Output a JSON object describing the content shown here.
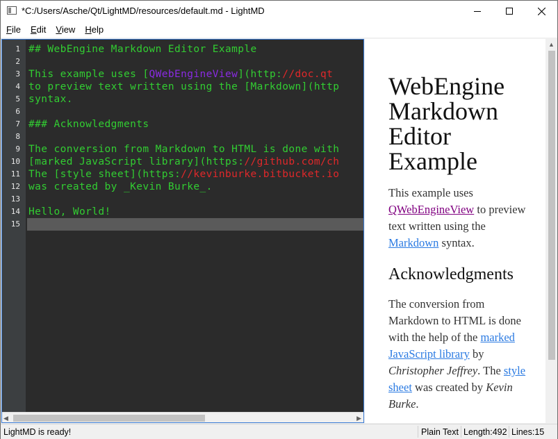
{
  "window": {
    "title": "*C:/Users/Asche/Qt/LightMD/resources/default.md - LightMD",
    "app_icon": "app-window-icon"
  },
  "menu": {
    "items": [
      {
        "label": "File",
        "mnemonic": "F"
      },
      {
        "label": "Edit",
        "mnemonic": "E"
      },
      {
        "label": "View",
        "mnemonic": "V"
      },
      {
        "label": "Help",
        "mnemonic": "H"
      }
    ]
  },
  "editor": {
    "line_numbers": [
      "1",
      "2",
      "3",
      "4",
      "5",
      "6",
      "7",
      "8",
      "9",
      "10",
      "11",
      "12",
      "13",
      "14",
      "15"
    ],
    "current_line": 15,
    "lines": [
      {
        "segments": [
          {
            "text": "## WebEngine Markdown Editor Example",
            "style": "normal"
          }
        ]
      },
      {
        "segments": []
      },
      {
        "segments": [
          {
            "text": "This example uses [",
            "style": "normal"
          },
          {
            "text": "QWebEngineView",
            "style": "purple"
          },
          {
            "text": "](http:",
            "style": "normal"
          },
          {
            "text": "//doc.qt",
            "style": "red"
          }
        ]
      },
      {
        "segments": [
          {
            "text": "to preview text written using the [Markdown](http",
            "style": "normal"
          }
        ]
      },
      {
        "segments": [
          {
            "text": "syntax.",
            "style": "normal"
          }
        ]
      },
      {
        "segments": []
      },
      {
        "segments": [
          {
            "text": "### Acknowledgments",
            "style": "normal"
          }
        ]
      },
      {
        "segments": []
      },
      {
        "segments": [
          {
            "text": "The conversion from Markdown to HTML is done with",
            "style": "normal"
          }
        ]
      },
      {
        "segments": [
          {
            "text": "[marked JavaScript library](https:",
            "style": "normal"
          },
          {
            "text": "//github.com/ch",
            "style": "red"
          }
        ]
      },
      {
        "segments": [
          {
            "text": "The [style sheet](https:",
            "style": "normal"
          },
          {
            "text": "//kevinburke.bitbucket.io",
            "style": "red"
          }
        ]
      },
      {
        "segments": [
          {
            "text": "was created by _Kevin Burke_.",
            "style": "normal"
          }
        ]
      },
      {
        "segments": []
      },
      {
        "segments": [
          {
            "text": "Hello, World!",
            "style": "normal"
          }
        ]
      },
      {
        "segments": []
      }
    ]
  },
  "preview": {
    "heading": "WebEngine Markdown Editor Example",
    "para1": {
      "before": "This example uses ",
      "link1": "QWebEngineView",
      "middle": " to preview text written using the ",
      "link2": "Markdown",
      "after": " syntax."
    },
    "subheading": "Acknowledgments",
    "para2": {
      "before": "The conversion from Markdown to HTML is done with the help of the ",
      "link1": "marked JavaScript library",
      "middle1": " by ",
      "author1": "Christopher Jeffrey",
      "middle2": ". The ",
      "link2": "style sheet",
      "middle3": " was created by ",
      "author2": "Kevin Burke",
      "after": "."
    }
  },
  "status": {
    "message": "LightMD is ready!",
    "format": "Plain Text",
    "length": "Length:492",
    "lines": "Lines:15"
  },
  "colors": {
    "editor_bg": "#2b2b2b",
    "gutter_bg": "#3c3f41",
    "code_text": "#32cd32",
    "link_url": "#e0282a",
    "link_text": "#8a2be2",
    "current_line": "#5a5a5a",
    "preview_link": "#2a7ae2"
  }
}
